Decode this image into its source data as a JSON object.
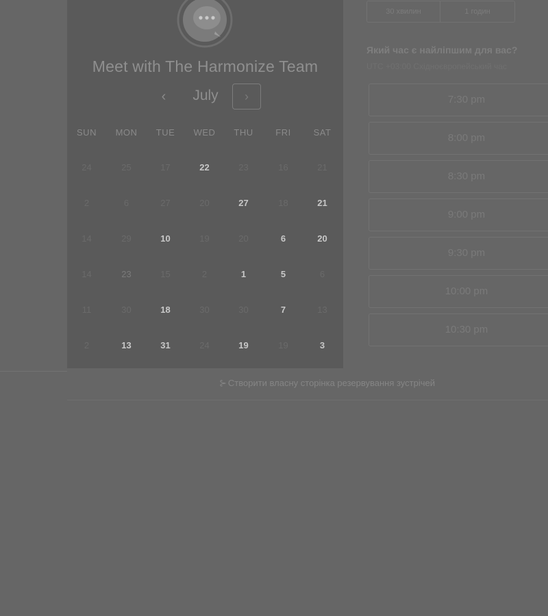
{
  "header": {
    "title": "Meet with The Harmonize Team",
    "logo_icon": "chat-bubble-icon"
  },
  "calendar": {
    "month": "July",
    "prev_icon": "chevron-left-icon",
    "next_icon": "chevron-right-icon",
    "prev_glyph": "‹",
    "next_glyph": "›",
    "weekdays": [
      "SUN",
      "MON",
      "TUE",
      "WED",
      "THU",
      "FRI",
      "SAT"
    ],
    "weeks": [
      [
        {
          "label": "24",
          "available": false
        },
        {
          "label": "25",
          "available": false
        },
        {
          "label": "17",
          "available": false
        },
        {
          "label": "22",
          "available": true
        },
        {
          "label": "23",
          "available": false
        },
        {
          "label": "16",
          "available": false
        },
        {
          "label": "21",
          "available": false
        }
      ],
      [
        {
          "label": "2",
          "available": false
        },
        {
          "label": "6",
          "available": false
        },
        {
          "label": "27",
          "available": false
        },
        {
          "label": "20",
          "available": false
        },
        {
          "label": "27",
          "available": true
        },
        {
          "label": "18",
          "available": false
        },
        {
          "label": "21",
          "available": true
        }
      ],
      [
        {
          "label": "14",
          "available": false
        },
        {
          "label": "29",
          "available": false
        },
        {
          "label": "10",
          "available": true
        },
        {
          "label": "19",
          "available": false
        },
        {
          "label": "20",
          "available": false
        },
        {
          "label": "6",
          "available": true
        },
        {
          "label": "20",
          "available": true
        }
      ],
      [
        {
          "label": "14",
          "available": false
        },
        {
          "label": "23",
          "available": true,
          "selected": true
        },
        {
          "label": "15",
          "available": false
        },
        {
          "label": "2",
          "available": false
        },
        {
          "label": "1",
          "available": true
        },
        {
          "label": "5",
          "available": true
        },
        {
          "label": "6",
          "available": false
        }
      ],
      [
        {
          "label": "11",
          "available": false
        },
        {
          "label": "30",
          "available": false
        },
        {
          "label": "18",
          "available": true
        },
        {
          "label": "30",
          "available": false
        },
        {
          "label": "30",
          "available": false
        },
        {
          "label": "7",
          "available": true
        },
        {
          "label": "13",
          "available": false
        }
      ],
      [
        {
          "label": "2",
          "available": false
        },
        {
          "label": "13",
          "available": true
        },
        {
          "label": "31",
          "available": true
        },
        {
          "label": "24",
          "available": false
        },
        {
          "label": "19",
          "available": true
        },
        {
          "label": "19",
          "available": false
        },
        {
          "label": "3",
          "available": true
        }
      ]
    ]
  },
  "booking": {
    "durations": [
      "30 хвилин",
      "1 годин"
    ],
    "question": "Який час є найліпшим для вас?",
    "timezone": "UTC +03:00 Східноєвропейський час",
    "slots": [
      "7:30 pm",
      "8:00 pm",
      "8:30 pm",
      "9:00 pm",
      "9:30 pm",
      "10:00 pm",
      "10:30 pm"
    ]
  },
  "footer": {
    "link_icon": "arrow-icon",
    "link_glyph": "⊱",
    "link_text": "Створити власну сторінка резервування зустрічей"
  },
  "colors": {
    "overlay": "#666666",
    "panel": "#5a5a5a",
    "selected_day": "#a7a7a7"
  }
}
